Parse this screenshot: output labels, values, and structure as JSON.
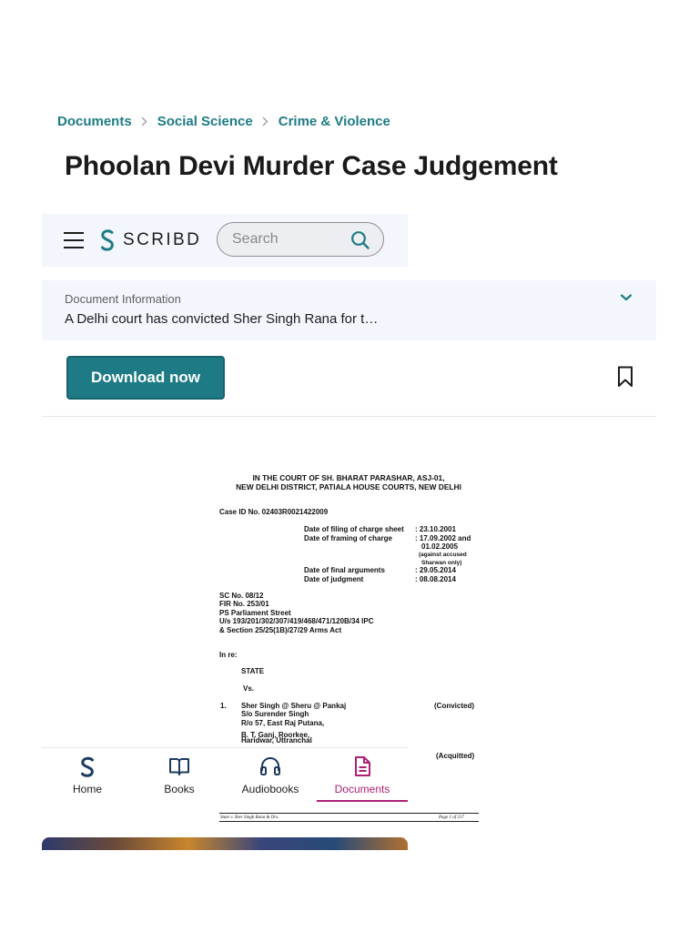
{
  "breadcrumb": [
    "Documents",
    "Social Science",
    "Crime & Violence"
  ],
  "page_title": "Phoolan Devi Murder Case Judgement",
  "header": {
    "logo_text": "SCRIBD",
    "search_placeholder": "Search",
    "search_value": ""
  },
  "doc_info": {
    "label": "Document Information",
    "description": "A Delhi court has convicted Sher Singh Rana for t…"
  },
  "actions": {
    "download_label": "Download now"
  },
  "document_preview": {
    "court_line_1": "IN THE COURT OF SH. BHARAT PARASHAR, ASJ-01,",
    "court_line_2": "NEW DELHI DISTRICT, PATIALA HOUSE COURTS, NEW DELHI",
    "case_id": "Case ID No. 02403R0021422009",
    "dates": [
      {
        "label": "Date of filing of charge sheet",
        "value": ": 23.10.2001"
      },
      {
        "label": "Date of framing of charge",
        "value": ": 17.09.2002 and"
      },
      {
        "label": "",
        "value": "01.02.2005"
      },
      {
        "label": "",
        "value": "(against accused"
      },
      {
        "label": "",
        "value": "Sharwan only)"
      },
      {
        "label": "Date of final arguments",
        "value": ": 29.05.2014"
      },
      {
        "label": "Date of judgment",
        "value": ": 08.08.2014"
      }
    ],
    "case_lines": [
      "SC No.  08/12",
      "FIR No.  253/01",
      "PS  Parliament Street",
      "U/s 193/201/302/307/419/468/471/120B/34 IPC",
      "& Section 25/25(1B)/27/29 Arms Act"
    ],
    "in_re": "In re:",
    "state": "STATE",
    "vs": "Vs.",
    "accused_no": "1.",
    "accused_lines": [
      "Sher Singh @ Sheru @ Pankaj",
      "S/o Surender Singh",
      "R/o 57, East Raj Putana,",
      "B. T. Ganj, Roorkee,",
      "Haridwar, Uttranchal"
    ],
    "convicted": "(Convicted)",
    "acquitted": "(Acquitted)",
    "footer_left": "State v.  Sher Singh Rana & Ors.",
    "footer_right": "Page 1 of  217"
  },
  "bottom_nav": [
    {
      "label": "Home",
      "icon": "scribd-logo-icon",
      "active": false
    },
    {
      "label": "Books",
      "icon": "open-book-icon",
      "active": false
    },
    {
      "label": "Audiobooks",
      "icon": "headphones-icon",
      "active": false
    },
    {
      "label": "Documents",
      "icon": "document-icon",
      "active": true
    }
  ],
  "colors": {
    "accent": "#1e7b85",
    "active_nav": "#ad1f74",
    "panel_bg": "#f3f6fd"
  }
}
